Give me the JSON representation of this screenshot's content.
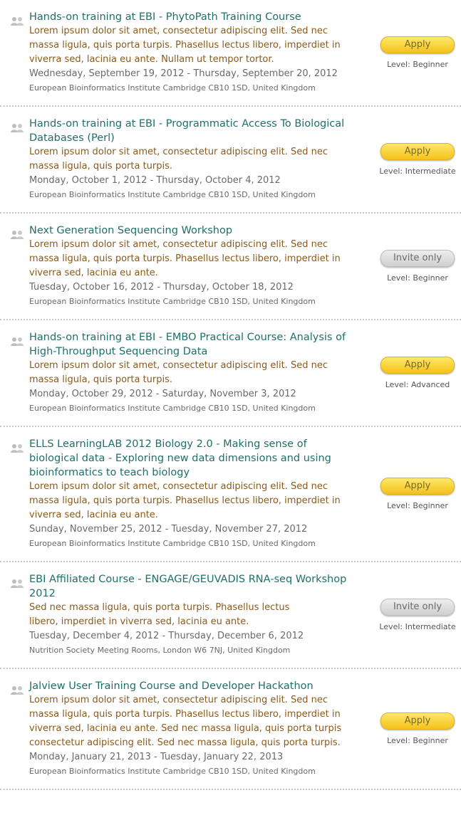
{
  "courses": [
    {
      "title": "Hands-on training at EBI - PhytoPath Training Course",
      "description": "Lorem ipsum dolor sit amet, consectetur adipiscing elit. Sed nec massa ligula, quis porta turpis. Phasellus lectus libero, imperdiet in viverra sed, lacinia eu ante. Nullam ut tempor tortor.",
      "dates": "Wednesday, September 19, 2012 - Thursday, September 20, 2012",
      "location": "European Bioinformatics Institute Cambridge CB10 1SD, United Kingdom",
      "button": "Apply",
      "button_type": "apply",
      "level": "Level: Beginner"
    },
    {
      "title": "Hands-on training at EBI - Programmatic Access To Biological Databases (Perl)",
      "description": "Lorem ipsum dolor sit amet, consectetur adipiscing elit. Sed nec massa ligula, quis porta turpis.",
      "dates": "Monday, October 1, 2012 - Thursday, October 4, 2012",
      "location": "European Bioinformatics Institute Cambridge CB10 1SD, United Kingdom",
      "button": "Apply",
      "button_type": "apply",
      "level": "Level: Intermediate"
    },
    {
      "title": "Next Generation Sequencing Workshop",
      "description": "Lorem ipsum dolor sit amet, consectetur adipiscing elit. Sed nec massa ligula, quis porta turpis. Phasellus lectus libero, imperdiet in viverra sed, lacinia eu ante.",
      "dates": "Tuesday, October 16, 2012 - Thursday, October 18, 2012",
      "location": "European Bioinformatics Institute Cambridge CB10 1SD, United Kingdom",
      "button": "Invite only",
      "button_type": "invite",
      "level": "Level: Beginner"
    },
    {
      "title": "Hands-on training at EBI - EMBO Practical Course: Analysis of High-Throughput Sequencing Data",
      "description": "Lorem ipsum dolor sit amet, consectetur adipiscing elit. Sed nec massa ligula, quis porta turpis.",
      "dates": "Monday, October 29, 2012 - Saturday, November 3, 2012",
      "location": "European Bioinformatics Institute Cambridge CB10 1SD, United Kingdom",
      "button": "Apply",
      "button_type": "apply",
      "level": "Level: Advanced"
    },
    {
      "title": "ELLS LearningLAB 2012 Biology 2.0 - Making sense of biological data - Exploring new data dimensions and using bioinformatics to teach biology",
      "description": "Lorem ipsum dolor sit amet, consectetur adipiscing elit. Sed nec massa ligula, quis porta turpis. Phasellus lectus libero, imperdiet in viverra sed, lacinia eu ante.",
      "dates": "Sunday, November 25, 2012 - Tuesday, November 27, 2012",
      "location": "European Bioinformatics Institute Cambridge CB10 1SD, United Kingdom",
      "button": "Apply",
      "button_type": "apply",
      "level": "Level: Beginner"
    },
    {
      "title": "EBI Affiliated Course - ENGAGE/GEUVADIS RNA-seq Workshop 2012",
      "description": "Sed nec massa ligula, quis porta turpis. Phasellus lectus libero, imperdiet in viverra sed, lacinia eu ante.",
      "dates": "Tuesday, December 4, 2012 - Thursday, December 6, 2012",
      "location": "Nutrition Society Meeting Rooms, London W6 7NJ, United Kingdom",
      "button": "Invite only",
      "button_type": "invite",
      "level": "Level: Intermediate"
    },
    {
      "title": "Jalview User Training Course and Developer Hackathon",
      "description": "Lorem ipsum dolor sit amet, consectetur adipiscing elit. Sed nec massa ligula, quis porta turpis. Phasellus lectus libero, imperdiet in viverra sed, lacinia eu ante. Sed nec massa ligula, quis porta turpis consectetur adipiscing elit. Sed nec massa ligula, quis porta turpis.",
      "dates": "Monday, January 21, 2013 - Tuesday, January 22, 2013",
      "location": "European Bioinformatics Institute Cambridge CB10 1SD, United Kingdom",
      "button": "Apply",
      "button_type": "apply",
      "level": "Level: Beginner"
    }
  ]
}
